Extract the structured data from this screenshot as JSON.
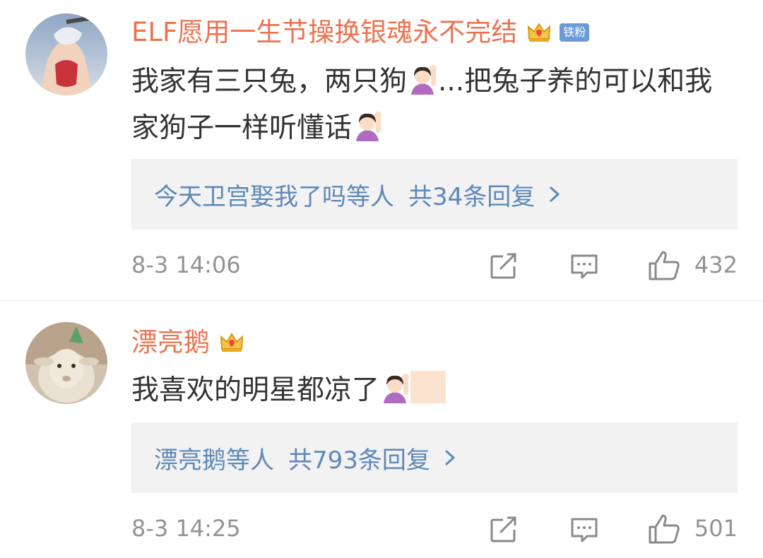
{
  "comments": [
    {
      "username": "ELF愿用一生节操换银魂永不完结",
      "fan_badge": "铁粉",
      "text_part1": "我家有三只兔，两只狗",
      "text_part2": "...把兔子养的可以和我家狗子一样听懂话",
      "replies_preview": "今天卫宫娶我了吗等人",
      "replies_count": "共34条回复",
      "timestamp": "8-3 14:06",
      "likes": "432"
    },
    {
      "username": "漂亮鹅",
      "text_part1": "我喜欢的明星都凉了",
      "replies_preview": "漂亮鹅等人",
      "replies_count": "共793条回复",
      "timestamp": "8-3 14:25",
      "likes": "501"
    }
  ],
  "icons": {
    "crown": "crown-icon",
    "emoji": "raising-hand-emoji-icon",
    "share": "share-icon",
    "comment": "comment-icon",
    "like": "thumbs-up-icon",
    "chevron": "chevron-right-icon"
  },
  "colors": {
    "username": "#eb7350",
    "reply_link": "#5d88b8",
    "meta": "#939393",
    "reply_bg": "#f2f2f2",
    "badge": "#6b9bd6"
  }
}
